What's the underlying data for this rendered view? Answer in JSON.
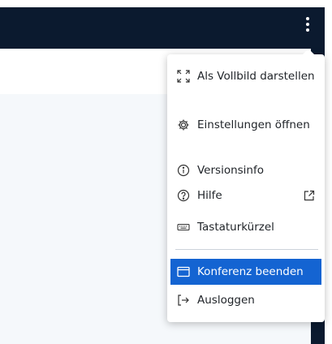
{
  "menu": {
    "items": [
      {
        "label": "Als Vollbild darstellen",
        "icon": "fullscreen-icon"
      },
      {
        "label": "Einstellungen öffnen",
        "icon": "gear-icon"
      },
      {
        "label": "Versionsinfo",
        "icon": "info-icon"
      },
      {
        "label": "Hilfe",
        "icon": "help-icon",
        "extra_icon": "external-link-icon"
      },
      {
        "label": "Tastaturkürzel",
        "icon": "keyboard-icon"
      },
      {
        "label": "Konferenz beenden",
        "icon": "window-icon",
        "highlighted": true
      },
      {
        "label": "Ausloggen",
        "icon": "logout-icon"
      }
    ]
  },
  "colors": {
    "topbar": "#0b1a2f",
    "highlight": "#1464d2",
    "content_background": "#f5f8fb"
  }
}
